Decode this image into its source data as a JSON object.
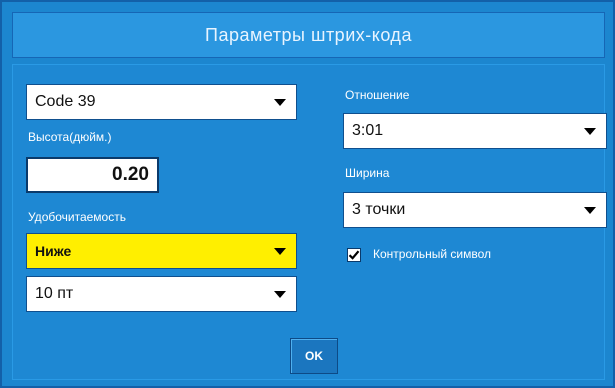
{
  "dialog": {
    "title": "Параметры штрих-кода",
    "ok_label": "OK"
  },
  "barcode": {
    "symbology": "Code 39",
    "height_label": "Высота(дюйм.)",
    "height_value": "0.20",
    "readability_label": "Удобочитаемость",
    "readability_position": "Ниже",
    "font_size": "10 пт",
    "ratio_label": "Отношение",
    "ratio_value": "3:01",
    "width_label": "Ширина",
    "width_value": "3 точки",
    "checksum_label": "Контрольный символ",
    "checksum_checked": true
  },
  "colors": {
    "background": "#1c86cf",
    "highlight": "#ffef00"
  }
}
